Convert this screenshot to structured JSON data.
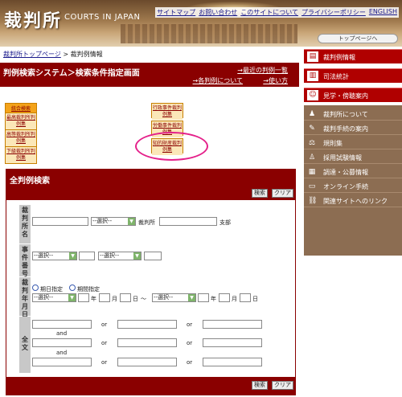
{
  "header": {
    "logo": "裁判所",
    "logo_en": "COURTS IN JAPAN",
    "top_links": [
      "サイトマップ",
      "お問い合わせ",
      "このサイトについて",
      "プライバシーポリシー",
      "ENGLISH"
    ],
    "top_page_button": "トップページへ"
  },
  "breadcrumb": {
    "home": "裁判所トップページ",
    "separator": ">",
    "current": "裁判例情報"
  },
  "title_bar": {
    "title": "判例検索システム＞検索条件指定画面",
    "link_recent": "→最近の判例一覧",
    "link_about": "→各判例について",
    "link_howto": "→使い方"
  },
  "categories": {
    "col1_head": "統合検索",
    "col1_items": [
      "最高裁判所判例集",
      "高等裁判所判例集",
      "下級裁判所判例集"
    ],
    "col2_items": [
      "行政事件裁判例集",
      "労働事件裁判例集",
      "知的財産裁判例集"
    ]
  },
  "search_panel": {
    "title": "全判例検索",
    "search_button": "検索",
    "clear_button": "クリア",
    "labels": {
      "court_name": "裁判所名",
      "case_number": "事件番号",
      "decision_date": "裁判年月日",
      "full_text": "全文"
    },
    "court_select": "--選択--",
    "court_suffix": "裁判所",
    "branch_suffix": "支部",
    "case_select_1": "--選択--",
    "case_select_2": "--選択--",
    "radio_date": "期日指定",
    "radio_period": "期間指定",
    "date_select_from": "--選択--",
    "date_select_to": "--選択--",
    "unit_year": "年",
    "unit_month": "月",
    "unit_day": "日",
    "range_sep": "～",
    "op_and": "and",
    "op_or": "or"
  },
  "sidebar": {
    "red_items": [
      "裁判例情報",
      "司法統計",
      "見学・傍聴案内"
    ],
    "brown_items": [
      "裁判所について",
      "裁判手続の案内",
      "規則集",
      "採用試験情報",
      "調達・公募情報",
      "オンライン手続",
      "関連サイトへのリンク"
    ]
  },
  "colors": {
    "title_bar": "#8a0000",
    "category_orange": "#f4a31a",
    "highlight_pink": "#e4208a",
    "sidebar_red": "#b00000",
    "sidebar_brown": "#8c6d52"
  }
}
